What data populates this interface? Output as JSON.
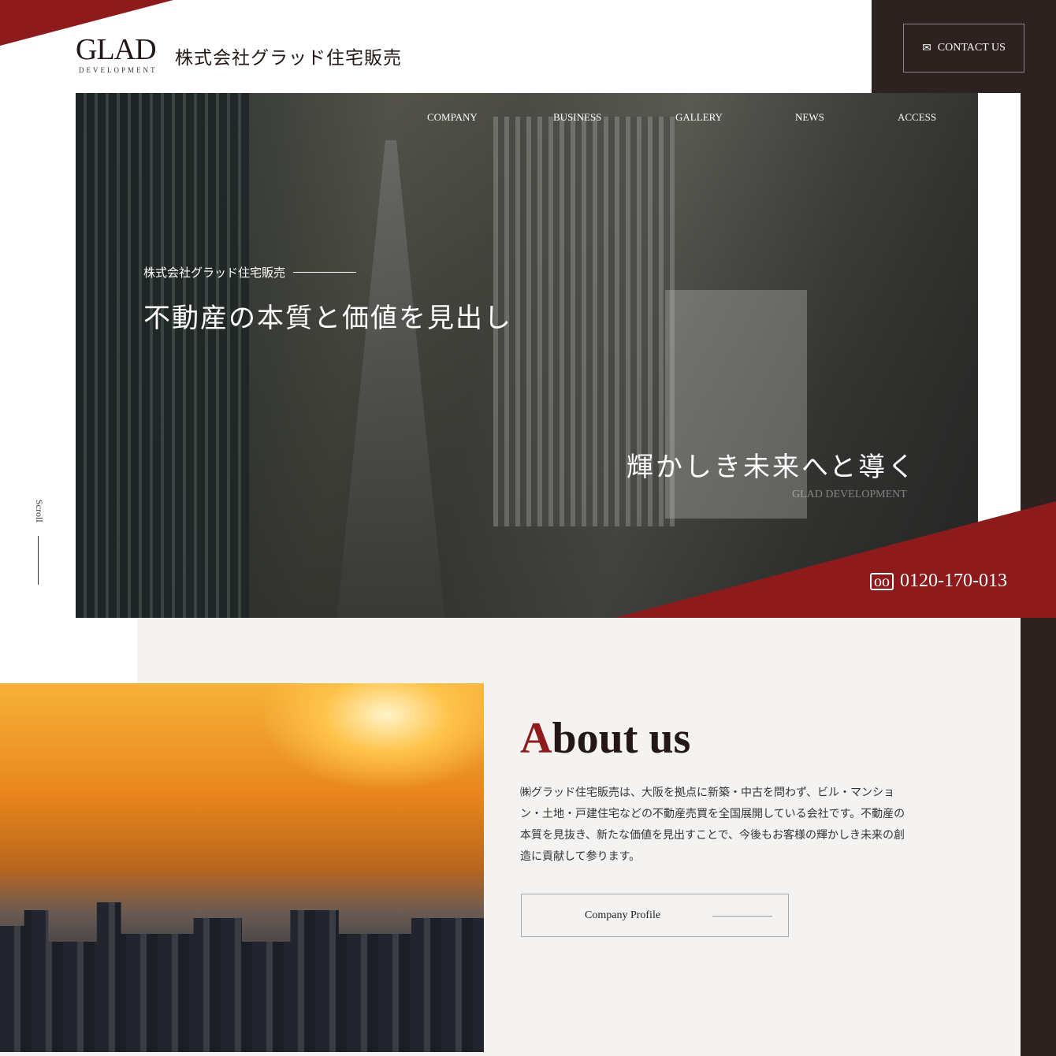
{
  "header": {
    "logo_en": "GLAD",
    "logo_sub": "DEVELOPMENT",
    "company_name": "株式会社グラッド住宅販売",
    "contact_label": "CONTACT US",
    "contact_icon": "mail-icon"
  },
  "nav": [
    {
      "label": "COMPANY"
    },
    {
      "label": "BUSINESS"
    },
    {
      "label": "GALLERY"
    },
    {
      "label": "NEWS"
    },
    {
      "label": "ACCESS"
    }
  ],
  "hero": {
    "sub": "株式会社グラッド住宅販売",
    "title1": "不動産の本質と価値を見出し",
    "title2": "輝かしき未来へと導く",
    "en": "GLAD DEVELOPMENT",
    "phone": "0120-170-013",
    "phone_icon": "free-dial-icon"
  },
  "scroll": "Scroll",
  "about": {
    "title_first": "A",
    "title_rest": "bout us",
    "text": "㈱グラッド住宅販売は、大阪を拠点に新築・中古を問わず、ビル・マンション・土地・戸建住宅などの不動産売買を全国展開している会社です。不動産の本質を見抜き、新たな価値を見出すことで、今後もお客様の輝かしき未来の創造に貢献して参ります。",
    "button": "Company Profile"
  },
  "colors": {
    "accent": "#8e1b1b",
    "dark": "#2d2220",
    "bg": "#f4f3f1"
  }
}
